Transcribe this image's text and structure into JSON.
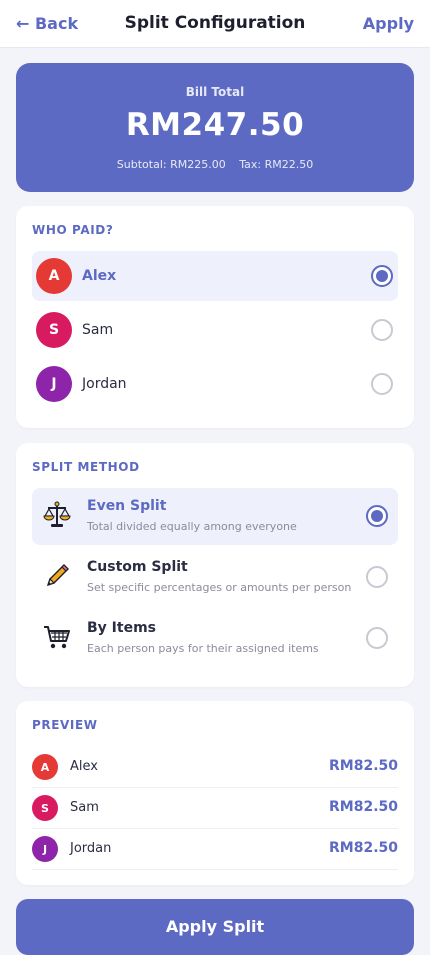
{
  "header": {
    "back_label": "← Back",
    "title": "Split Configuration",
    "apply_label": "Apply"
  },
  "bill": {
    "label": "Bill Total",
    "total": "RM247.50",
    "subtotal": "Subtotal: RM225.00",
    "tax": "Tax: RM22.50"
  },
  "who_paid": {
    "title": "WHO PAID?",
    "people": [
      {
        "initial": "A",
        "name": "Alex",
        "color": "#e53935",
        "selected": true
      },
      {
        "initial": "S",
        "name": "Sam",
        "color": "#d81b60",
        "selected": false
      },
      {
        "initial": "J",
        "name": "Jordan",
        "color": "#8e24aa",
        "selected": false
      }
    ]
  },
  "split_method": {
    "title": "SPLIT METHOD",
    "options": [
      {
        "icon": "scales-icon",
        "name": "Even Split",
        "desc": "Total divided equally among everyone",
        "selected": true
      },
      {
        "icon": "pencil-icon",
        "name": "Custom Split",
        "desc": "Set specific percentages or amounts per person",
        "selected": false
      },
      {
        "icon": "cart-icon",
        "name": "By Items",
        "desc": "Each person pays for their assigned items",
        "selected": false
      }
    ]
  },
  "preview": {
    "title": "PREVIEW",
    "rows": [
      {
        "initial": "A",
        "name": "Alex",
        "amount": "RM82.50"
      },
      {
        "initial": "S",
        "name": "Sam",
        "amount": "RM82.50"
      },
      {
        "initial": "J",
        "name": "Jordan",
        "amount": "RM82.50"
      }
    ]
  },
  "apply_split_label": "Apply Split",
  "colors": {
    "accent": "#5c6ac4",
    "background": "#f3f4f9"
  }
}
